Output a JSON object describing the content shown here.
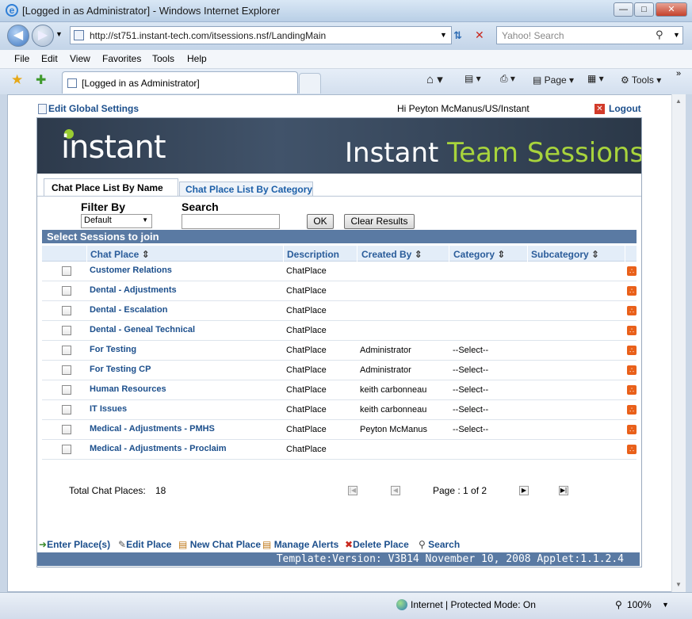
{
  "window": {
    "title": "[Logged in as Administrator] - Windows Internet Explorer",
    "min": "—",
    "max": "□",
    "close": "✕"
  },
  "browser": {
    "url": "http://st751.instant-tech.com/itsessions.nsf/LandingMain",
    "search_placeholder": "Yahoo! Search",
    "menu": [
      "File",
      "Edit",
      "View",
      "Favorites",
      "Tools",
      "Help"
    ],
    "tab_title": "[Logged in as Administrator]",
    "commands": {
      "page": "Page",
      "tools": "Tools"
    },
    "status": {
      "zone": "Internet | Protected Mode: On",
      "zoom": "100%"
    }
  },
  "header": {
    "edit_global": "Edit Global Settings",
    "greeting": "Hi Peyton McManus/US/Instant",
    "logout": "Logout"
  },
  "banner": {
    "logo": "instant",
    "product_a": "Instant ",
    "product_b": "Team Sessions"
  },
  "tabs": {
    "by_name": "Chat Place List By Name",
    "by_category": "Chat Place List By Category"
  },
  "filter": {
    "filter_label": "Filter By",
    "filter_value": "Default",
    "search_label": "Search",
    "ok": "OK",
    "clear": "Clear Results"
  },
  "section_title": "Select Sessions to join",
  "columns": {
    "place": "Chat Place",
    "description": "Description",
    "created_by": "Created By",
    "category": "Category",
    "subcategory": "Subcategory"
  },
  "rows": [
    {
      "name": "Customer Relations",
      "desc": "ChatPlace",
      "created": "",
      "category": ""
    },
    {
      "name": "Dental - Adjustments",
      "desc": "ChatPlace",
      "created": "",
      "category": ""
    },
    {
      "name": "Dental - Escalation",
      "desc": "ChatPlace",
      "created": "",
      "category": ""
    },
    {
      "name": "Dental - Geneal Technical",
      "desc": "ChatPlace",
      "created": "",
      "category": ""
    },
    {
      "name": "For Testing",
      "desc": "ChatPlace",
      "created": "Administrator",
      "category": "--Select--"
    },
    {
      "name": "For Testing CP",
      "desc": "ChatPlace",
      "created": "Administrator",
      "category": "--Select--"
    },
    {
      "name": "Human Resources",
      "desc": "ChatPlace",
      "created": "keith carbonneau",
      "category": "--Select--"
    },
    {
      "name": "IT Issues",
      "desc": "ChatPlace",
      "created": "keith carbonneau",
      "category": "--Select--"
    },
    {
      "name": "Medical - Adjustments - PMHS",
      "desc": "ChatPlace",
      "created": "Peyton McManus",
      "category": "--Select--"
    },
    {
      "name": "Medical - Adjustments - Proclaim",
      "desc": "ChatPlace",
      "created": "",
      "category": ""
    }
  ],
  "footer": {
    "total_label": "Total Chat Places:",
    "total": "18",
    "page_info": "Page : 1 of 2"
  },
  "actions": {
    "enter": "Enter Place(s)",
    "edit": "Edit Place",
    "new": "New Chat Place",
    "alerts": "Manage Alerts",
    "delete": "Delete Place",
    "search": "Search"
  },
  "version": "Template:Version: V3B14 November 10, 2008 Applet:1.1.2.4"
}
